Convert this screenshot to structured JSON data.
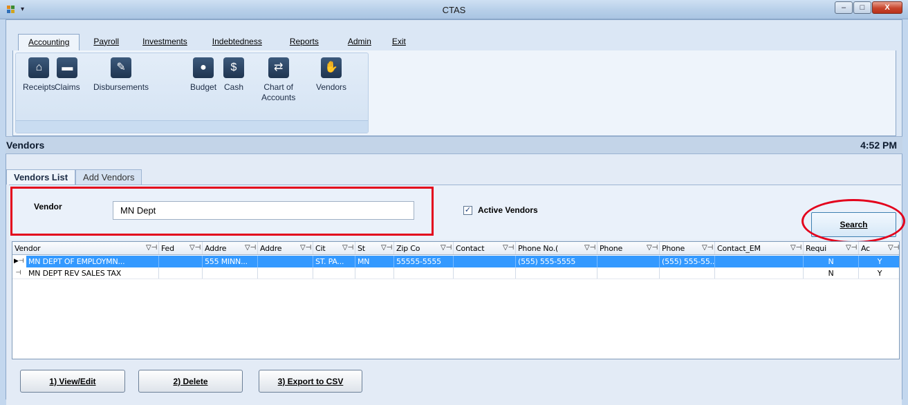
{
  "window": {
    "title": "CTAS",
    "min": "–",
    "max": "□",
    "close": "X"
  },
  "menu": {
    "tabs": [
      {
        "label": "Accounting"
      },
      {
        "label": "Payroll"
      },
      {
        "label": "Investments"
      },
      {
        "label": "Indebtedness"
      },
      {
        "label": "Reports"
      },
      {
        "label": "Admin"
      },
      {
        "label": "Exit"
      }
    ]
  },
  "ribbon": {
    "buttons": [
      {
        "line1": "Receipts",
        "line2": "",
        "icon": "receipts-icon"
      },
      {
        "line1": "Claims",
        "line2": "",
        "icon": "claims-icon"
      },
      {
        "line1": "Disbursements",
        "line2": "",
        "icon": "disbursements-icon"
      },
      {
        "line1": "Budget",
        "line2": "",
        "icon": "budget-icon"
      },
      {
        "line1": "Cash",
        "line2": "",
        "icon": "cash-icon"
      },
      {
        "line1": "Chart of",
        "line2": "Accounts",
        "icon": "chart-of-accounts-icon"
      },
      {
        "line1": "Vendors",
        "line2": "",
        "icon": "vendors-icon"
      }
    ]
  },
  "header": {
    "title": "Vendors",
    "time": "4:52 PM"
  },
  "subtabs": {
    "list": "Vendors List",
    "add": "Add Vendors"
  },
  "search": {
    "vendor_label": "Vendor",
    "vendor_value": "MN Dept",
    "active_label": "Active Vendors",
    "active_checked": "✓",
    "search_button": "Search"
  },
  "grid": {
    "columns": [
      "Vendor",
      "Fed",
      "Addre",
      "Addre",
      "Cit",
      "St",
      "Zip Co",
      "Contact",
      "Phone No.(",
      "Phone",
      "Phone",
      "Contact_EM",
      "Requi",
      "Ac"
    ],
    "filter_icon": "▽⊣",
    "rows": [
      [
        "MN DEPT OF EMPLOYMN...",
        "",
        "555 MINN...",
        "",
        "ST. PA...",
        "MN",
        "55555-5555",
        "",
        "(555) 555-5555",
        "",
        "(555) 555-55...",
        "",
        "N",
        "Y"
      ],
      [
        "MN DEPT REV SALES TAX",
        "",
        "",
        "",
        "",
        "",
        "",
        "",
        "",
        "",
        "",
        "",
        "N",
        "Y"
      ]
    ]
  },
  "buttons": {
    "view_edit": "1) View/Edit",
    "delete": "2) Delete",
    "export": "3) Export to CSV"
  },
  "colors": {
    "selection": "#3399ff",
    "highlight": "#e3001b"
  }
}
